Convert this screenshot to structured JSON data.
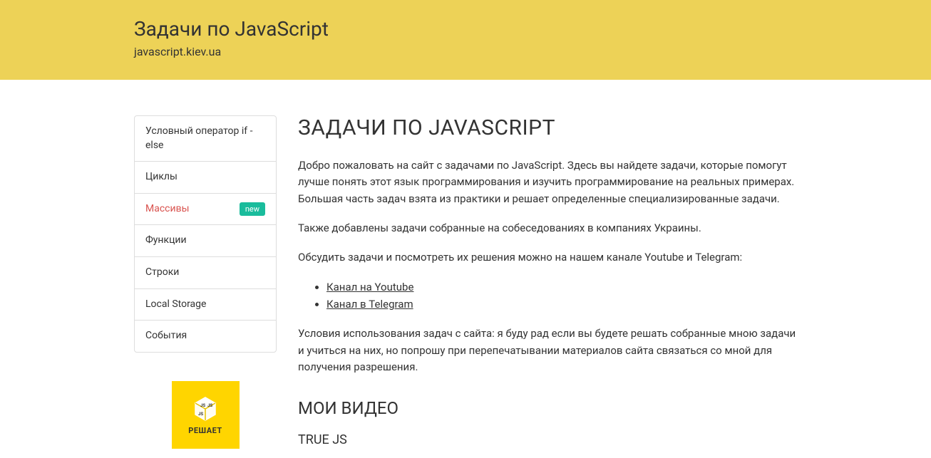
{
  "header": {
    "title": "Задачи по JavaScript",
    "subtitle": "javascript.kiev.ua"
  },
  "sidebar": {
    "items": [
      {
        "label": "Условный оператор if - else",
        "active": false,
        "badge": null
      },
      {
        "label": "Циклы",
        "active": false,
        "badge": null
      },
      {
        "label": "Массивы",
        "active": true,
        "badge": "new"
      },
      {
        "label": "Функции",
        "active": false,
        "badge": null
      },
      {
        "label": "Строки",
        "active": false,
        "badge": null
      },
      {
        "label": "Local Storage",
        "active": false,
        "badge": null
      },
      {
        "label": "События",
        "active": false,
        "badge": null
      }
    ],
    "promo_label": "РЕШАЕТ"
  },
  "content": {
    "heading": "ЗАДАЧИ ПО JAVASCRIPT",
    "p1": "Добро пожаловать на сайт с задачами по JavaScript. Здесь вы найдете задачи, которые помогут лучше понять этот язык программирования и изучить программирование на реальных примерах. Большая часть задач взята из практики и решает определенные специализированные задачи.",
    "p2": "Также добавлены задачи собранные на собеседованиях в компаниях Украины.",
    "p3": "Обсудить задачи и посмотреть их решения можно на нашем канале Youtube и Telegram:",
    "links": [
      "Канал на Youtube",
      "Канал в Telegram"
    ],
    "p4": "Условия использования задач с сайта: я буду рад если вы будете решать собранные мною задачи и учиться на них, но попрошу при перепечатывании материалов сайта связаться со мной для получения разрешения.",
    "h2": "МОИ ВИДЕО",
    "h3": "TRUE JS"
  }
}
